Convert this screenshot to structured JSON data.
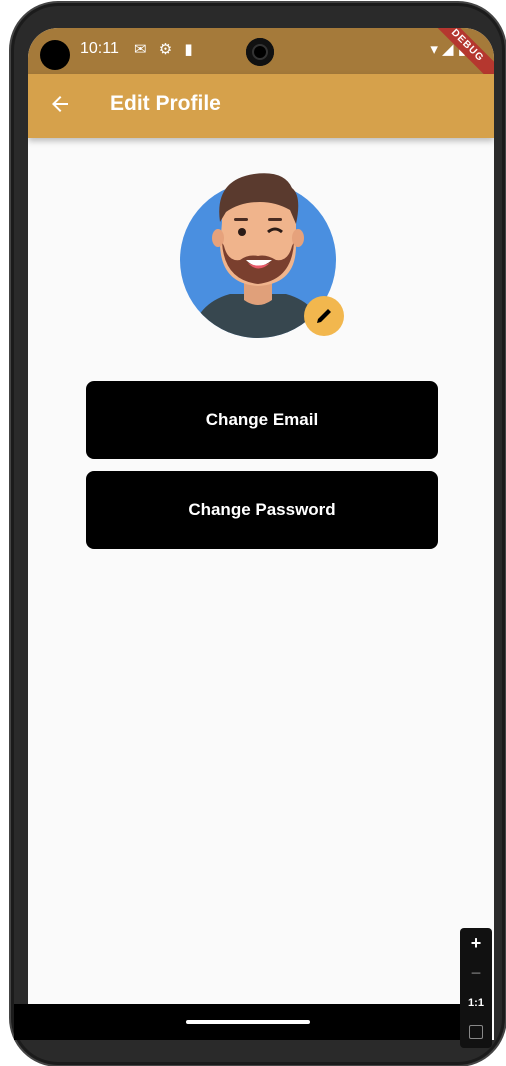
{
  "status_bar": {
    "time": "10:11",
    "icons": [
      "mail-icon",
      "settings-icon",
      "sd-card-icon"
    ],
    "system_icons": [
      "wifi-icon",
      "signal-icon",
      "battery-icon"
    ],
    "background": "#a57a3a"
  },
  "debug_banner": {
    "label": "DEBUG",
    "color": "#b5372f"
  },
  "app_bar": {
    "title": "Edit Profile",
    "back_icon": "arrow-back-icon",
    "background": "#d6a14b"
  },
  "avatar": {
    "edit_icon": "pencil-icon",
    "edit_badge_color": "#f2b74e",
    "circle_color": "#4a8fe0"
  },
  "buttons": {
    "change_email": "Change Email",
    "change_password": "Change Password",
    "background": "#000000"
  },
  "zoom_controls": {
    "plus": "+",
    "minus": "−",
    "fit": "1:1"
  }
}
